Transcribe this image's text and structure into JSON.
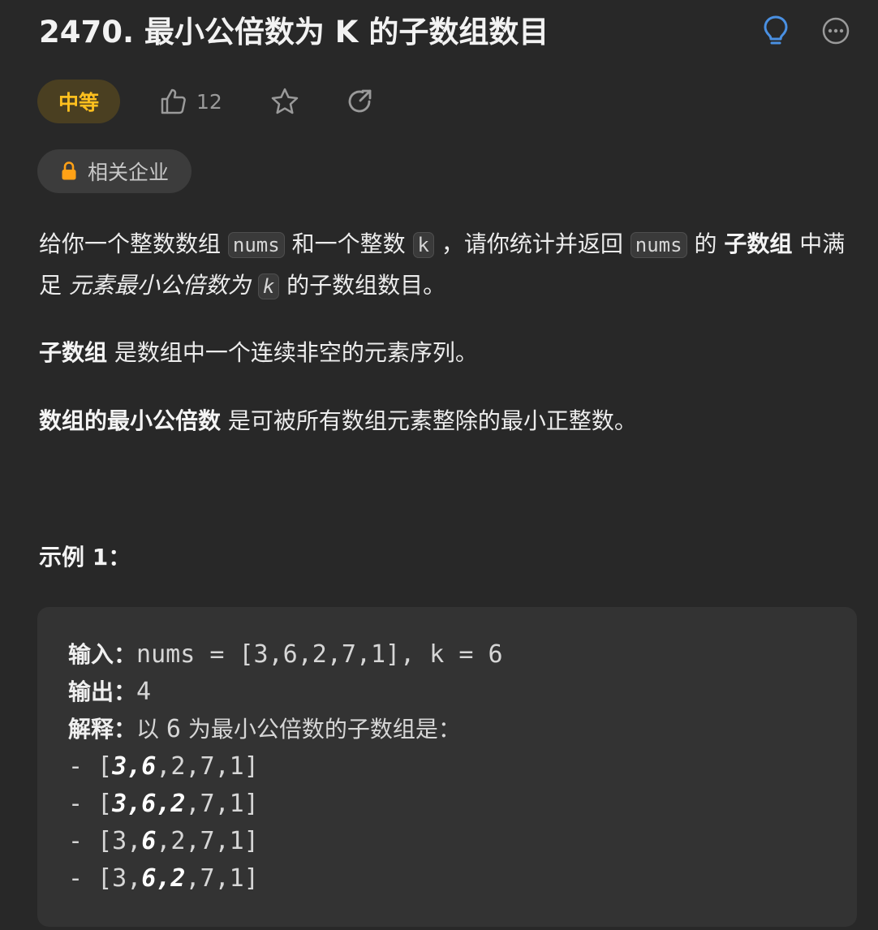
{
  "problem": {
    "title": "2470. 最小公倍数为 K 的子数组数目",
    "difficulty": "中等",
    "like_count": "12",
    "companies_label": "相关企业"
  },
  "description": {
    "p1_a": "给你一个整数数组 ",
    "p1_code1": "nums",
    "p1_b": " 和一个整数 ",
    "p1_code2": "k",
    "p1_c": " ，请你统计并返回 ",
    "p1_code3": "nums",
    "p1_d": " 的 ",
    "p1_bold1": "子数组",
    "p1_e": " 中满足 ",
    "p1_ital": "元素最小公倍数为 ",
    "p1_code4": "k",
    "p1_f": " 的子数组数目。",
    "p2_bold": "子数组",
    "p2_text": " 是数组中一个连续非空的元素序列。",
    "p3_bold": "数组的最小公倍数",
    "p3_text": " 是可被所有数组元素整除的最小正整数。"
  },
  "example": {
    "title": "示例 1：",
    "input_label": "输入：",
    "input_value": "nums = [3,6,2,7,1], k = 6",
    "output_label": "输出：",
    "output_value": "4",
    "explain_label": "解释：",
    "explain_a": "以 ",
    "explain_num": "6",
    "explain_b": " 为最小公倍数的子数组是：",
    "rows": [
      {
        "pre": "- [",
        "bold": "3,6",
        "post": ",2,7,1]",
        "mid": ""
      },
      {
        "pre": "- [",
        "bold": "3,6,2",
        "post": ",7,1]",
        "mid": ""
      },
      {
        "pre": "- [3,",
        "bold": "6",
        "post": ",2,7,1]",
        "mid": ""
      },
      {
        "pre": "- [3,",
        "bold": "6,2",
        "post": ",7,1]",
        "mid": ""
      }
    ]
  },
  "colors": {
    "background": "#282828",
    "difficulty_bg": "#4a3f21",
    "difficulty_text": "#ffc01e",
    "hint_icon": "#4a90e2"
  },
  "icons": [
    "lightbulb-icon",
    "more-options-icon",
    "thumbs-up-icon",
    "star-icon",
    "share-icon",
    "lock-icon"
  ]
}
